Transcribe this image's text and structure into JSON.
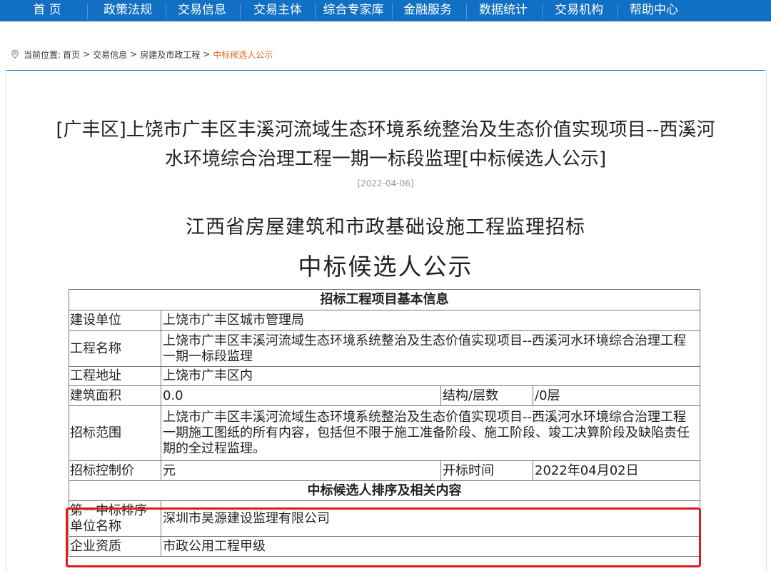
{
  "nav": {
    "items": [
      "首 页",
      "政策法规",
      "交易信息",
      "交易主体",
      "综合专家库",
      "金融服务",
      "数据统计",
      "交易机构",
      "帮助中心"
    ]
  },
  "breadcrumb": {
    "prefix": "当前位置:",
    "items": [
      "首页",
      "交易信息",
      "房建及市政工程"
    ],
    "current": "中标候选人公示",
    "separator": ">"
  },
  "article": {
    "title_line1": "[广丰区]上饶市广丰区丰溪河流域生态环境系统整治及生态价值实现项目--西溪河",
    "title_line2": "水环境综合治理工程一期一标段监理[中标候选人公示]",
    "date": "[2022-04-06]",
    "heading1": "江西省房屋建筑和市政基础设施工程监理招标",
    "heading2": "中标候选人公示"
  },
  "table": {
    "section1": "招标工程项目基本信息",
    "build_unit": {
      "label": "建设单位",
      "value": "上饶市广丰区城市管理局"
    },
    "project_name": {
      "label": "工程名称",
      "value": "上饶市广丰区丰溪河流域生态环境系统整治及生态价值实现项目--西溪河水环境综合治理工程一期一标段监理"
    },
    "project_address": {
      "label": "工程地址",
      "value": "上饶市广丰区内"
    },
    "building_area": {
      "label": "建筑面积",
      "value": "0.0",
      "structure_label": "结构/层数",
      "structure_value": "/0层"
    },
    "scope": {
      "label": "招标范围",
      "value": "上饶市广丰区丰溪河流域生态环境系统整治及生态价值实现项目--西溪河水环境综合治理工程一期施工图纸的所有内容，包括但不限于施工准备阶段、施工阶段、竣工决算阶段及缺陷责任期的全过程监理。"
    },
    "control_price": {
      "label": "招标控制价",
      "value": "元",
      "open_label": "开标时间",
      "open_value": "2022年04月02日"
    },
    "section2": "中标候选人排序及相关内容",
    "first_candidate": {
      "label": "第一中标排序单位名称",
      "value": "深圳市昊源建设监理有限公司"
    },
    "qualification": {
      "label": "企业资质",
      "value": "市政公用工程甲级"
    }
  },
  "colors": {
    "nav_bg": "#1270c4",
    "breadcrumb_current": "#e8661c",
    "highlight_box": "#e0191e"
  }
}
